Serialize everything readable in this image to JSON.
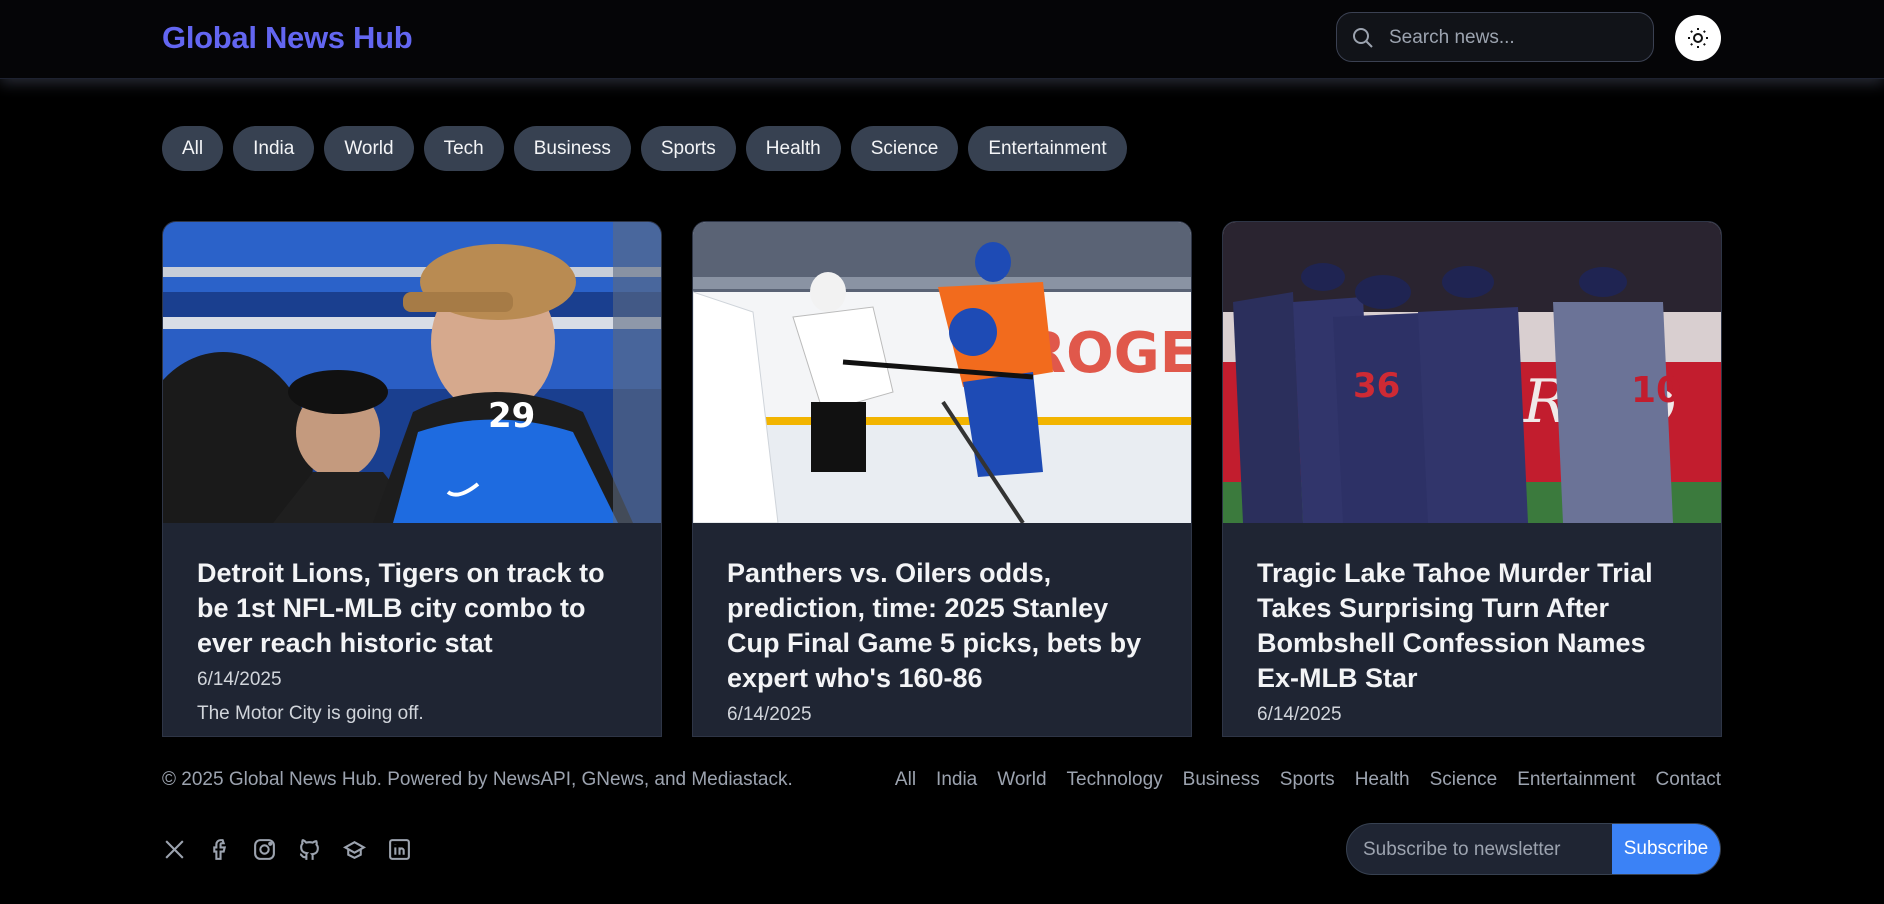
{
  "header": {
    "brand": "Global News Hub",
    "search_placeholder": "Search news..."
  },
  "categories": [
    "All",
    "India",
    "World",
    "Tech",
    "Business",
    "Sports",
    "Health",
    "Science",
    "Entertainment"
  ],
  "articles": [
    {
      "title": "Detroit Lions, Tigers on track to be 1st NFL-MLB city combo to ever reach historic stat",
      "date": "6/14/2025",
      "description": "The Motor City is going off."
    },
    {
      "title": "Panthers vs. Oilers odds, prediction, time: 2025 Stanley Cup Final Game 5 picks, bets by expert who's 160-86",
      "date": "6/14/2025",
      "description": ""
    },
    {
      "title": "Tragic Lake Tahoe Murder Trial Takes Surprising Turn After Bombshell Confession Names Ex-MLB Star",
      "date": "6/14/2025",
      "description": ""
    }
  ],
  "footer": {
    "copyright": "© 2025 Global News Hub. Powered by NewsAPI, GNews, and Mediastack.",
    "links": [
      "All",
      "India",
      "World",
      "Technology",
      "Business",
      "Sports",
      "Health",
      "Science",
      "Entertainment",
      "Contact"
    ],
    "socials": [
      "x-icon",
      "facebook-icon",
      "instagram-icon",
      "github-icon",
      "discord-icon",
      "linkedin-icon"
    ],
    "newsletter_placeholder": "Subscribe to newsletter",
    "subscribe_label": "Subscribe"
  },
  "colors": {
    "brand": "#6366f1",
    "chip_bg": "#374151",
    "card_bg": "#1f2533",
    "subscribe_bg": "#3b82f6"
  }
}
